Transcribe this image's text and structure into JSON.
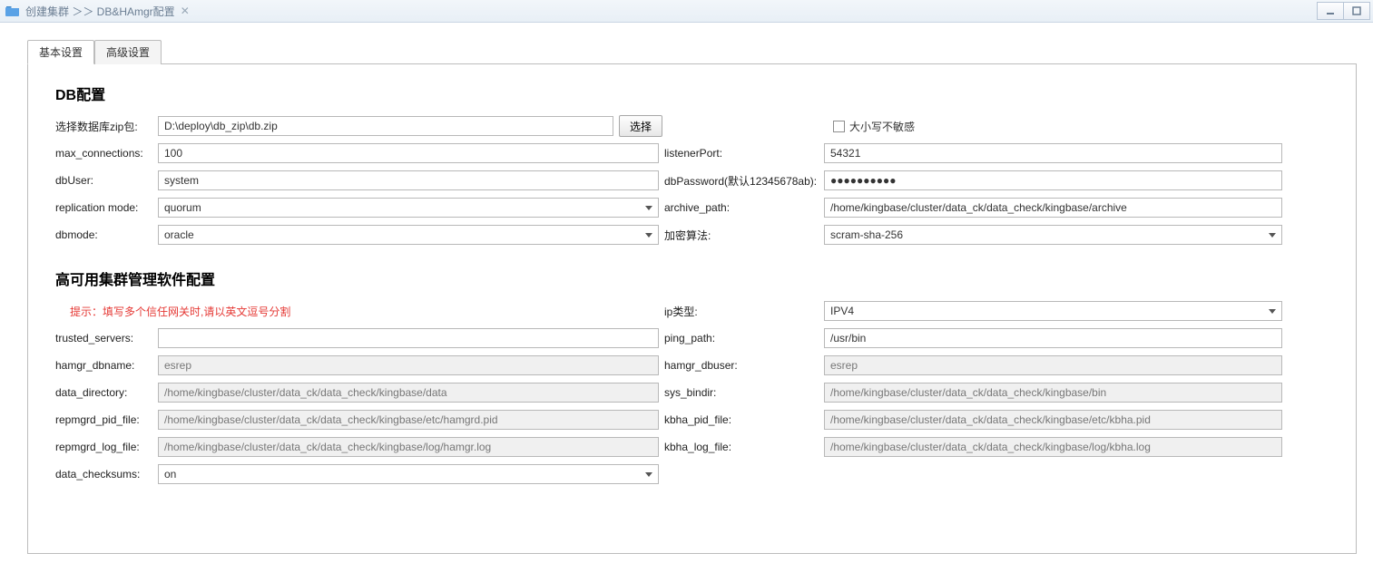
{
  "titlebar": {
    "breadcrumb": "创建集群 ＞＞ DB&HAmgr配置"
  },
  "tabs": {
    "basic": "基本设置",
    "advanced": "高级设置"
  },
  "section1": {
    "title": "DB配置",
    "zip_label": "选择数据库zip包:",
    "zip_value": "D:\\deploy\\db_zip\\db.zip",
    "select_btn": "选择",
    "case_insensitive_label": "大小写不敏感",
    "max_conn_label": "max_connections:",
    "max_conn_value": "100",
    "listener_label": "listenerPort:",
    "listener_value": "54321",
    "dbuser_label": "dbUser:",
    "dbuser_value": "system",
    "dbpass_label": "dbPassword(默认12345678ab):",
    "dbpass_value": "●●●●●●●●●●",
    "repl_label": "replication mode:",
    "repl_value": "quorum",
    "archive_label": "archive_path:",
    "archive_value": "/home/kingbase/cluster/data_ck/data_check/kingbase/archive",
    "dbmode_label": "dbmode:",
    "dbmode_value": "oracle",
    "enc_label": "加密算法:",
    "enc_value": "scram-sha-256"
  },
  "section2": {
    "title": "高可用集群管理软件配置",
    "hint": "提示：填写多个信任网关时,请以英文逗号分割",
    "iptype_label": "ip类型:",
    "iptype_value": "IPV4",
    "trusted_label": "trusted_servers:",
    "trusted_value": "",
    "ping_label": "ping_path:",
    "ping_value": "/usr/bin",
    "hamgr_dbname_label": "hamgr_dbname:",
    "hamgr_dbname_value": "esrep",
    "hamgr_dbuser_label": "hamgr_dbuser:",
    "hamgr_dbuser_value": "esrep",
    "data_dir_label": "data_directory:",
    "data_dir_value": "/home/kingbase/cluster/data_ck/data_check/kingbase/data",
    "sys_bindir_label": "sys_bindir:",
    "sys_bindir_value": "/home/kingbase/cluster/data_ck/data_check/kingbase/bin",
    "repmgrd_pid_label": "repmgrd_pid_file:",
    "repmgrd_pid_value": "/home/kingbase/cluster/data_ck/data_check/kingbase/etc/hamgrd.pid",
    "kbha_pid_label": "kbha_pid_file:",
    "kbha_pid_value": "/home/kingbase/cluster/data_ck/data_check/kingbase/etc/kbha.pid",
    "repmgrd_log_label": "repmgrd_log_file:",
    "repmgrd_log_value": "/home/kingbase/cluster/data_ck/data_check/kingbase/log/hamgr.log",
    "kbha_log_label": "kbha_log_file:",
    "kbha_log_value": "/home/kingbase/cluster/data_ck/data_check/kingbase/log/kbha.log",
    "checksums_label": "data_checksums:",
    "checksums_value": "on"
  }
}
